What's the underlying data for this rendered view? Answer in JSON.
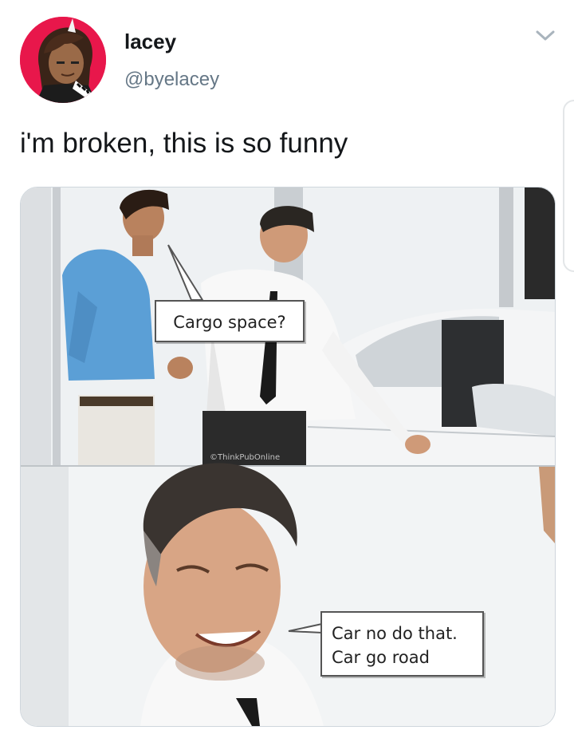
{
  "tweet": {
    "author": {
      "display_name": "lacey",
      "handle": "@byelacey",
      "avatar_icon": "avatar-image"
    },
    "menu_icon": "chevron-down-icon",
    "text": "i'm broken, this is so funny",
    "colors": {
      "avatar_bg": "#e8174b",
      "name": "#14171a",
      "handle": "#657786",
      "border": "#cfd6dc"
    }
  },
  "meme": {
    "panel_top": {
      "speech": "Cargo space?",
      "watermark": "©ThinkPubOnline"
    },
    "panel_bottom": {
      "speech": "Car no do that.\nCar go road"
    }
  }
}
